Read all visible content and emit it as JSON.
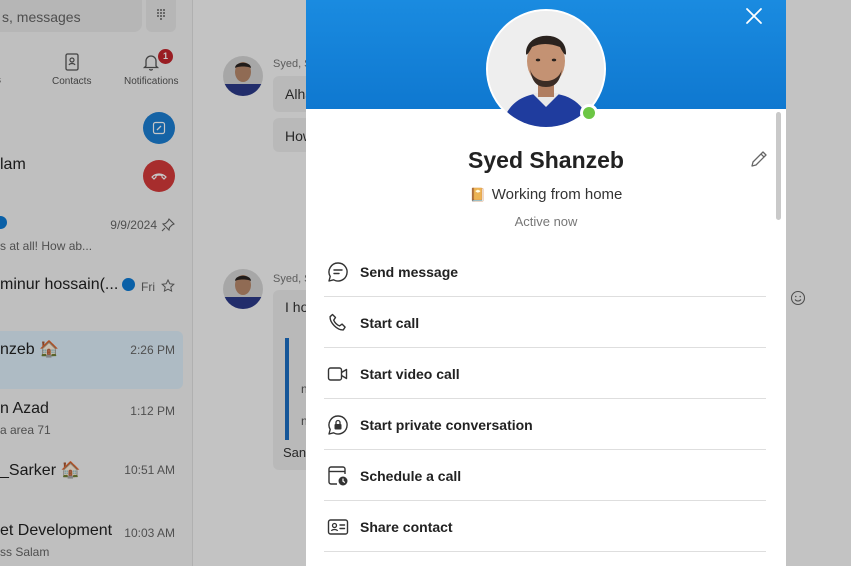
{
  "sidebar": {
    "search_placeholder": "s, messages",
    "dialpad_icon": "dialpad-icon",
    "tabs": [
      {
        "label": "s"
      },
      {
        "label": "Contacts"
      },
      {
        "label": "Notifications",
        "badge": "1"
      }
    ],
    "chats": [
      {
        "name": "lam",
        "preview": "",
        "time": ""
      },
      {
        "name": "",
        "preview": "s at all! How ab...",
        "time": "9/9/2024"
      },
      {
        "name": "minur hossain(...",
        "preview": "",
        "time": "Fri"
      },
      {
        "name": "nzeb 🏠",
        "preview": "",
        "time": "2:26 PM"
      },
      {
        "name": "n Azad",
        "preview": "a area 71",
        "time": "1:12 PM"
      },
      {
        "name": "_Sarker 🏠",
        "preview": "",
        "time": "10:51 AM"
      },
      {
        "name": "et Development",
        "preview": "ss Salam",
        "time": "10:03 AM"
      }
    ]
  },
  "conversation": {
    "sender_1": "Syed, S",
    "bubble_1a": "Alha",
    "bubble_1b": "How",
    "sender_2": "Syed, S",
    "bubble_2a": "I ho",
    "bubble_2b": "n",
    "bubble_2c": "n",
    "bubble_2d": "San"
  },
  "profile": {
    "name": "Syed Shanzeb",
    "mood_emoji": "📔",
    "mood": "Working from home",
    "status": "Active now",
    "presence_color": "#6cc644",
    "banner_color": "#1383db",
    "actions": [
      {
        "label": "Send message",
        "icon": "chat-bubble-icon"
      },
      {
        "label": "Start call",
        "icon": "phone-icon"
      },
      {
        "label": "Start video call",
        "icon": "video-camera-icon"
      },
      {
        "label": "Start private conversation",
        "icon": "lock-chat-icon"
      },
      {
        "label": "Schedule a call",
        "icon": "calendar-clock-icon"
      },
      {
        "label": "Share contact",
        "icon": "contact-card-icon"
      }
    ]
  }
}
